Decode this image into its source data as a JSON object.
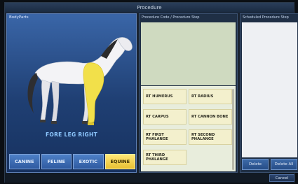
{
  "window": {
    "title": "Procedure"
  },
  "body_parts": {
    "header": "BodyParts",
    "selected_part": "FORE LEG RIGHT",
    "species": [
      {
        "label": "CANINE",
        "active": false
      },
      {
        "label": "FELINE",
        "active": false
      },
      {
        "label": "EXOTIC",
        "active": false
      },
      {
        "label": "EQUINE",
        "active": true
      }
    ]
  },
  "procedure": {
    "header": "Procedure Code / Procedure Step",
    "steps": [
      "RT HUMERUS",
      "RT RADIUS",
      "RT CARPUS",
      "RT CANNON BONE",
      "RT FIRST PHALANGE",
      "RT SECOND PHALANGE",
      "RT THIRD PHALANGE"
    ]
  },
  "scheduled": {
    "header": "Scheduled Procedure Step",
    "delete_label": "Delete",
    "delete_all_label": "Delete All"
  },
  "footer": {
    "cancel_label": "Cancel"
  },
  "colors": {
    "highlight": "#f2e04a",
    "panel_blue": "#2f5aa0"
  }
}
